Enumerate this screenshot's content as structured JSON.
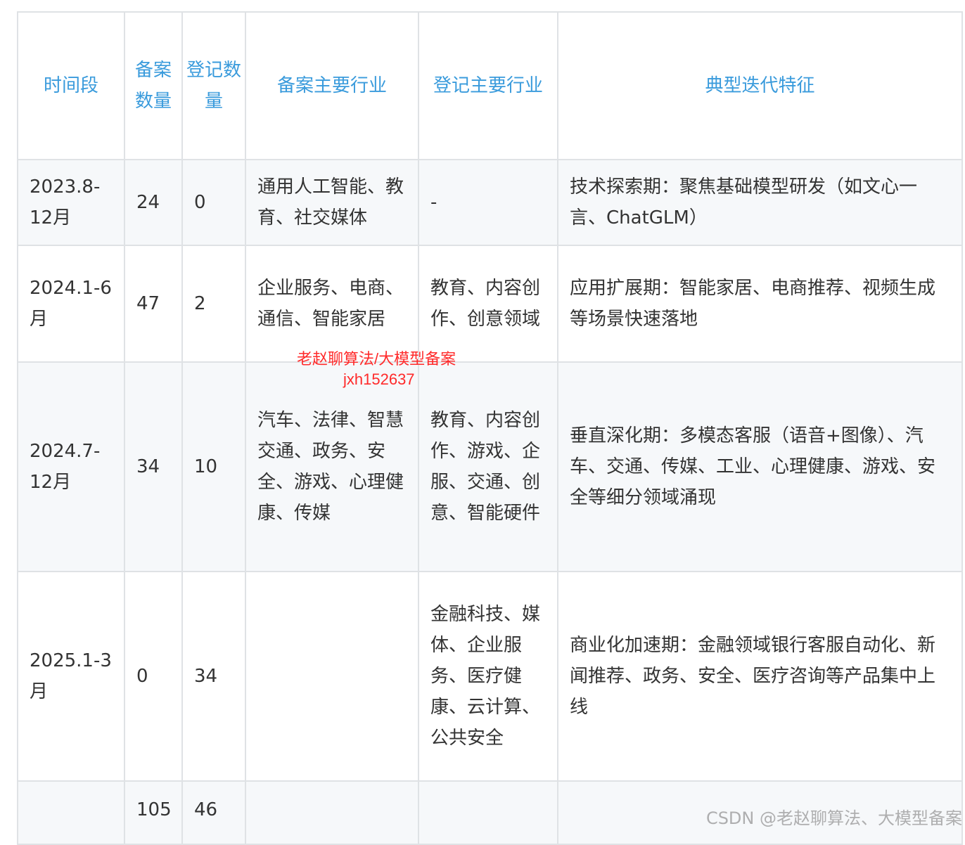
{
  "table": {
    "headers": [
      "时间段",
      "备案数量",
      "登记数量",
      "备案主要行业",
      "登记主要行业",
      "典型迭代特征"
    ],
    "rows": [
      [
        "2023.8-12月",
        "24",
        "0",
        "通用人工智能、教育、社交媒体",
        "-",
        "技术探索期：聚焦基础模型研发（如文心一言、ChatGLM）"
      ],
      [
        "2024.1-6月",
        "47",
        "2",
        "企业服务、电商、通信、智能家居",
        "教育、内容创作、创意领域",
        "应用扩展期：智能家居、电商推荐、视频生成等场景快速落地"
      ],
      [
        "2024.7-12月",
        "34",
        "10",
        "汽车、法律、智慧交通、政务、安全、游戏、心理健康、传媒",
        "教育、内容创作、游戏、企服、交通、创意、智能硬件",
        "垂直深化期：多模态客服（语音+图像）、汽车、交通、传媒、工业、心理健康、游戏、安全等细分领域涌现"
      ],
      [
        "2025.1-3月",
        "0",
        "34",
        "",
        "金融科技、媒体、企业服务、医疗健康、云计算、公共安全",
        "商业化加速期：金融领域银行客服自动化、新闻推荐、政务、安全、医疗咨询等产品集中上线"
      ],
      [
        "",
        "105",
        "46",
        "",
        "",
        ""
      ]
    ]
  },
  "watermark": {
    "line1": "老赵聊算法/大模型备案",
    "line2": "jxh152637",
    "footer": "CSDN @老赵聊算法、大模型备案"
  },
  "colors": {
    "header_text": "#3a9bdc",
    "border": "#dfe2e5",
    "stripe": "#f6f8fa",
    "watermark": "#ff2a2a"
  }
}
